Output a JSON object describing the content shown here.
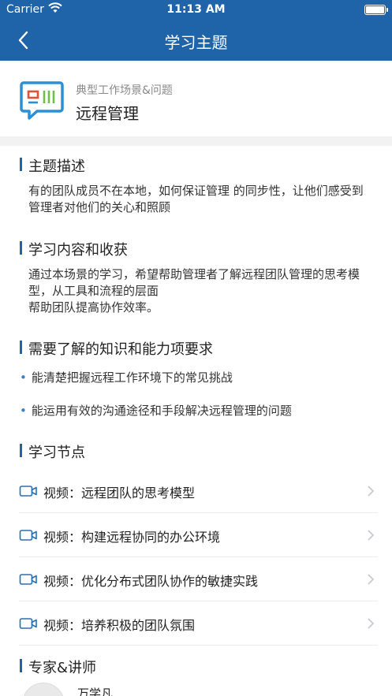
{
  "status_bar": {
    "carrier": "Carrier",
    "time": "11:13 AM"
  },
  "nav": {
    "title": "学习主题"
  },
  "topic": {
    "category": "典型工作场景&问题",
    "title": "远程管理"
  },
  "sections": {
    "description": {
      "heading": "主题描述",
      "text": "有的团队成员不在本地，如何保证管理 的同步性，让他们感受到管理者对他们的关心和照顾"
    },
    "content": {
      "heading": "学习内容和收获",
      "lines": [
        "通过本场景的学习，希望帮助管理者了解远程团队管理的思考模型，从工具和流程的层面",
        "帮助团队提高协作效率。"
      ]
    },
    "requirements": {
      "heading": "需要了解的知识和能力项要求",
      "items": [
        "能清楚把握远程工作环境下的常见挑战",
        "能运用有效的沟通途径和手段解决远程管理的问题"
      ]
    },
    "nodes": {
      "heading": "学习节点",
      "items": [
        "视频：远程团队的思考模型",
        "视频：构建远程协同的办公环境",
        "视频：优化分布式团队协作的敏捷实践",
        "视频：培养积极的团队氛围"
      ]
    },
    "experts": {
      "heading": "专家&讲师",
      "first_name": "万学凡"
    }
  },
  "colors": {
    "primary": "#1f64a8",
    "accent_icon": "#2b8fd6",
    "green": "#6cc04a",
    "red": "#e0533a"
  },
  "icons": {
    "back": "chevron-left-icon",
    "topic": "chat-board-icon",
    "video": "video-camera-icon",
    "chevron": "chevron-right-icon"
  }
}
